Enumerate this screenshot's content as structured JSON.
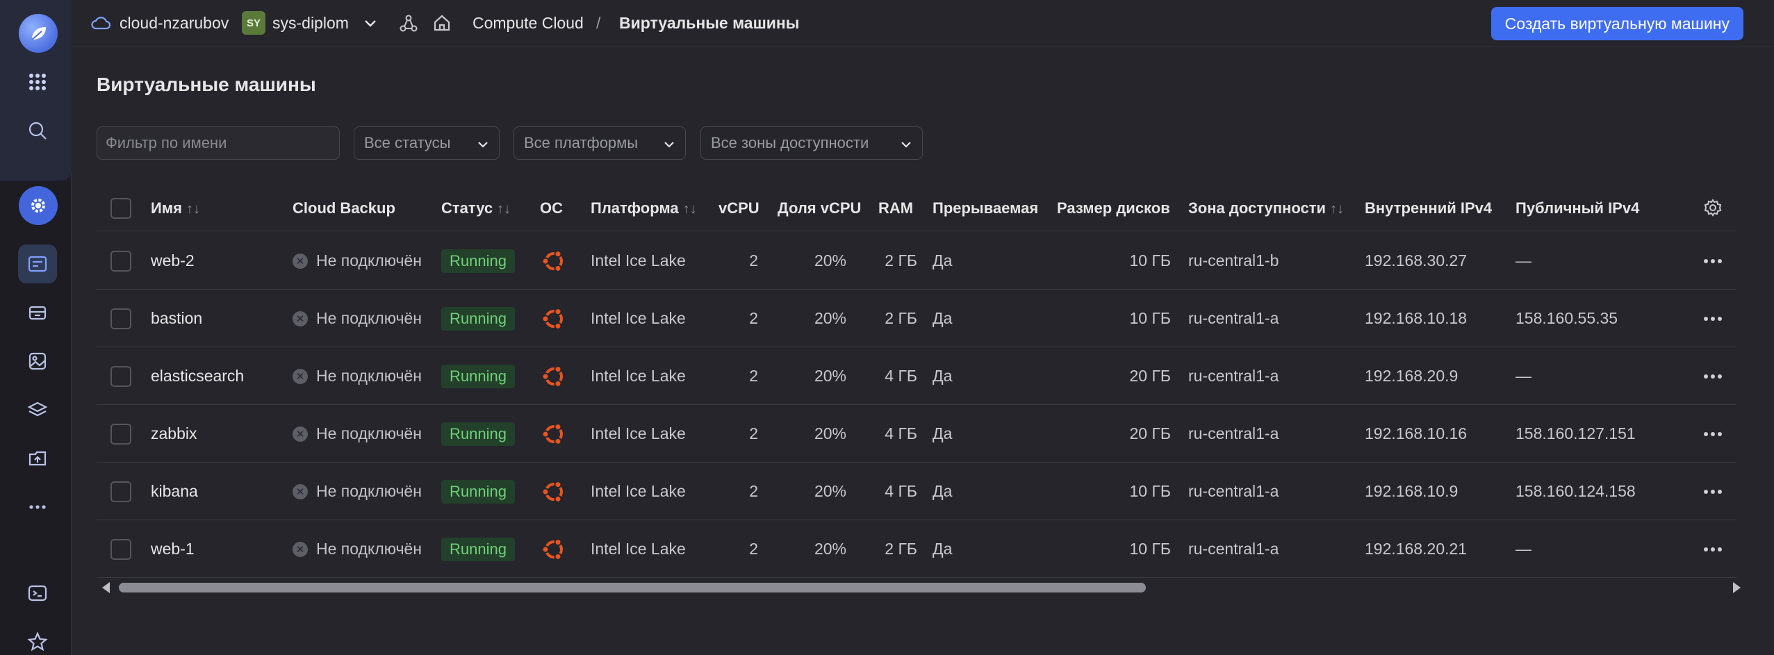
{
  "header": {
    "cloud": "cloud-nzarubov",
    "folder_badge": "SY",
    "folder": "sys-diplom",
    "crumb_service": "Compute Cloud",
    "crumb_sep": "/",
    "crumb_page": "Виртуальные машины",
    "create_button": "Создать виртуальную машину"
  },
  "page": {
    "title": "Виртуальные машины"
  },
  "filters": {
    "name_placeholder": "Фильтр по имени",
    "status": "Все статусы",
    "platform": "Все платформы",
    "zone": "Все зоны доступности"
  },
  "columns": {
    "name": "Имя",
    "backup": "Cloud Backup",
    "status": "Статус",
    "os": "ОС",
    "platform": "Платформа",
    "vcpu": "vCPU",
    "vcpu_share": "Доля vCPU",
    "ram": "RAM",
    "preemptible": "Прерываемая",
    "disk": "Размер дисков",
    "zone": "Зона доступности",
    "ip_internal": "Внутренний IPv4",
    "ip_public": "Публичный IPv4"
  },
  "rows": [
    {
      "name": "web-2",
      "backup": "Не подключён",
      "status": "Running",
      "platform": "Intel Ice Lake",
      "vcpu": "2",
      "share": "20%",
      "ram": "2 ГБ",
      "preempt": "Да",
      "disk": "10 ГБ",
      "zone": "ru-central1-b",
      "ip_int": "192.168.30.27",
      "ip_pub": "—"
    },
    {
      "name": "bastion",
      "backup": "Не подключён",
      "status": "Running",
      "platform": "Intel Ice Lake",
      "vcpu": "2",
      "share": "20%",
      "ram": "2 ГБ",
      "preempt": "Да",
      "disk": "10 ГБ",
      "zone": "ru-central1-a",
      "ip_int": "192.168.10.18",
      "ip_pub": "158.160.55.35"
    },
    {
      "name": "elasticsearch",
      "backup": "Не подключён",
      "status": "Running",
      "platform": "Intel Ice Lake",
      "vcpu": "2",
      "share": "20%",
      "ram": "4 ГБ",
      "preempt": "Да",
      "disk": "20 ГБ",
      "zone": "ru-central1-a",
      "ip_int": "192.168.20.9",
      "ip_pub": "—"
    },
    {
      "name": "zabbix",
      "backup": "Не подключён",
      "status": "Running",
      "platform": "Intel Ice Lake",
      "vcpu": "2",
      "share": "20%",
      "ram": "4 ГБ",
      "preempt": "Да",
      "disk": "20 ГБ",
      "zone": "ru-central1-a",
      "ip_int": "192.168.10.16",
      "ip_pub": "158.160.127.151"
    },
    {
      "name": "kibana",
      "backup": "Не подключён",
      "status": "Running",
      "platform": "Intel Ice Lake",
      "vcpu": "2",
      "share": "20%",
      "ram": "4 ГБ",
      "preempt": "Да",
      "disk": "10 ГБ",
      "zone": "ru-central1-a",
      "ip_int": "192.168.10.9",
      "ip_pub": "158.160.124.158"
    },
    {
      "name": "web-1",
      "backup": "Не подключён",
      "status": "Running",
      "platform": "Intel Ice Lake",
      "vcpu": "2",
      "share": "20%",
      "ram": "2 ГБ",
      "preempt": "Да",
      "disk": "10 ГБ",
      "zone": "ru-central1-a",
      "ip_int": "192.168.20.21",
      "ip_pub": "—"
    }
  ],
  "colors": {
    "accent": "#3f6df2",
    "ubuntu": "#e9541f",
    "running_bg": "#23402a",
    "running_text": "#6fd07a"
  },
  "icons": [
    "logo-icon",
    "apps-grid-icon",
    "search-icon",
    "settings-icon",
    "compute-icon",
    "disk-icon",
    "image-icon",
    "layers-icon",
    "backup-icon",
    "more-icon",
    "terminal-icon",
    "star-icon",
    "cloud-icon",
    "chevron-down-icon",
    "graph-icon",
    "home-icon",
    "ubuntu-icon",
    "gear-icon",
    "row-menu-icon"
  ]
}
